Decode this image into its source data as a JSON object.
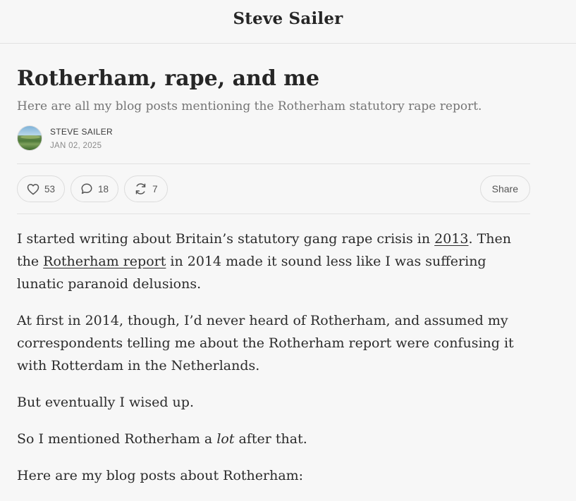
{
  "header": {
    "site_title": "Steve Sailer"
  },
  "post": {
    "title": "Rotherham, rape, and me",
    "subtitle": "Here are all my blog posts mentioning the Rotherham statutory rape report.",
    "author": "STEVE SAILER",
    "date": "JAN 02, 2025"
  },
  "actions": {
    "likes": "53",
    "comments": "18",
    "restacks": "7",
    "share_label": "Share"
  },
  "body": {
    "p1_a": "I started writing about Britain’s statutory gang rape crisis in ",
    "p1_link1": "2013",
    "p1_b": ". Then the ",
    "p1_link2": "Rotherham report",
    "p1_c": " in 2014 made it sound less like I was suffering lunatic paranoid delusions.",
    "p2": "At first in 2014, though, I’d never heard of Rotherham, and assumed my correspondents telling me about the Rotherham report were confusing it with Rotterdam in the Netherlands.",
    "p3": "But eventually I wised up.",
    "p4_a": "So I mentioned Rotherham a ",
    "p4_em": "lot",
    "p4_b": " after that.",
    "p5": "Here are my blog posts about Rotherham:"
  },
  "icons": {
    "like": "heart-icon",
    "comment": "speech-bubble-icon",
    "restack": "restack-arrows-icon"
  }
}
